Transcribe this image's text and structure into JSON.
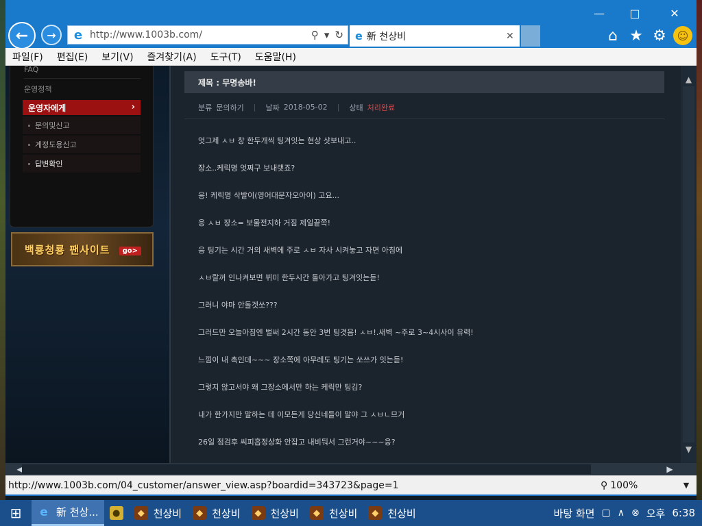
{
  "window": {
    "minimize_icon": "minimize-icon",
    "maximize_icon": "maximize-icon",
    "close_icon": "close-icon"
  },
  "address_bar": {
    "url": "http://www.1003b.com/",
    "search_icon": "search-icon",
    "dropdown_icon": "chevron-down-icon",
    "refresh_icon": "refresh-icon"
  },
  "tab": {
    "title": "新 천상비",
    "close": "✕"
  },
  "menu": [
    {
      "label": "파일(F)"
    },
    {
      "label": "편집(E)"
    },
    {
      "label": "보기(V)"
    },
    {
      "label": "즐겨찾기(A)"
    },
    {
      "label": "도구(T)"
    },
    {
      "label": "도움말(H)"
    }
  ],
  "sidebar": {
    "faq": "FAQ",
    "policy": "운영정책",
    "active": "운영자에게",
    "subitems": [
      {
        "label": "문의및신고"
      },
      {
        "label": "계정도용신고"
      },
      {
        "label": "답변확인"
      }
    ],
    "banner_text": "백룡청룡 팬사이트",
    "banner_go": "go>"
  },
  "post": {
    "subject": "제목 : 무명송바!",
    "category_label": "분류",
    "category": "문의하기",
    "date_label": "날짜",
    "date": "2018-05-02",
    "status_label": "상태",
    "status": "처리완료",
    "status_color": "#e04848",
    "lines": [
      "엇그제 ㅅㅂ 창 한두개씩 팅겨잇는 현상 샷보내고..",
      "장소..케릭명 엇쩌구 보내랫죠?",
      "응! 케릭명 삭발이(영어대문자오아이) 고요...",
      "응 ㅅㅂ 장소= 보물전지하 거짐 제일끝쪽!",
      "응 팅기는 시간 거의 새벽에 주로 ㅅㅂ 자사 시켜놓고 자면 아침에",
      "ㅅㅂ랄꺼 인나켜보면 뷔미 한두시간 돌아가고 팅겨잇는듣!",
      "그러니 야마 안돌겟쏘???",
      "그러드만 오늘아침엔 벌써 2시간 동안 3번 팅겻음! ㅅㅂ!.새벽 ~주로 3~4시사이 유력!",
      "느낌이 내 촉인데~~~ 장소쪽에 아무레도 팅기는 쏘쓰가 잇는듣!",
      "그렇지 않고서야 왜 그장소에서만 하는 케릭만 팅김?",
      "내가 한가지만 말하는 데 이모든게 당신네들이 말야 그 ㅅㅂㄴ므거",
      "26일 점검후 씨피흡정상화 안잡고 내비둬서 그런거야~~~응?"
    ]
  },
  "status_bar": {
    "url": "http://www.1003b.com/04_customer/answer_view.asp?boardid=343723&page=1",
    "zoom": "100%"
  },
  "taskbar": {
    "items": [
      {
        "label": "新 천상..."
      },
      {
        "label": "천상비"
      },
      {
        "label": "천상비"
      },
      {
        "label": "천상비"
      },
      {
        "label": "천상비"
      },
      {
        "label": "천상비"
      }
    ],
    "desktop": "바탕 화면",
    "ampm": "오후",
    "time": "6:38"
  },
  "colors": {
    "accent": "#1979ca",
    "sidebar_active": "#9b1111",
    "taskbar": "#1b4f8c"
  }
}
